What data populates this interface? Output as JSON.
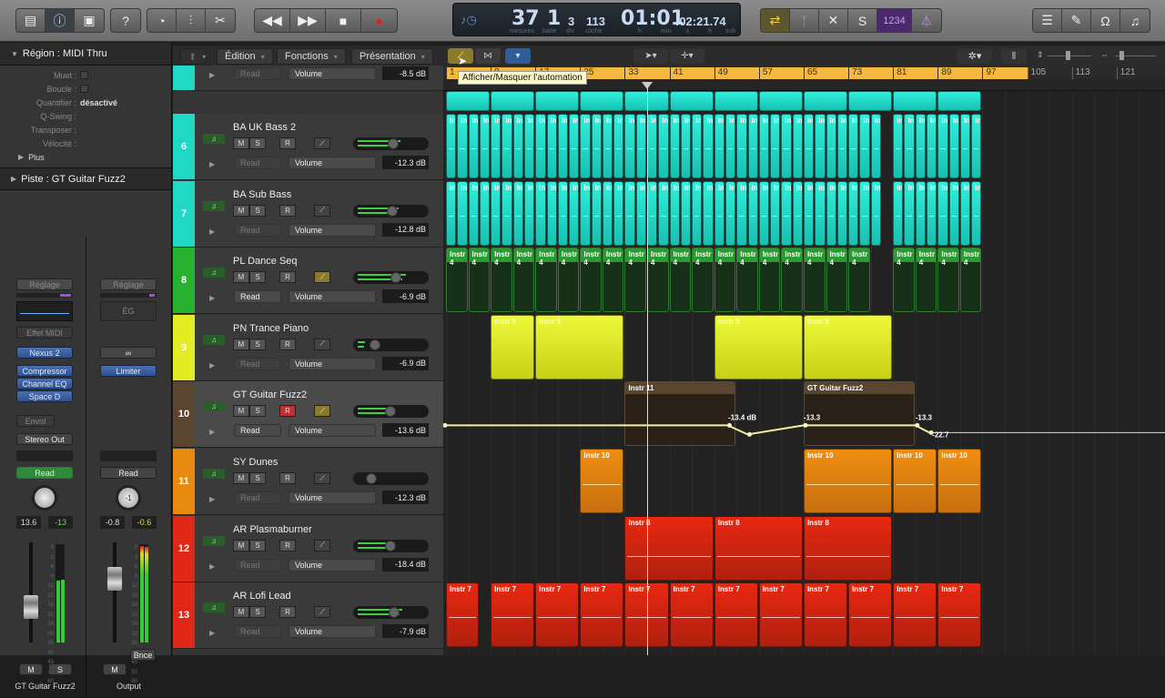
{
  "toolbar": {
    "left_buttons": [
      "library-icon",
      "inspector-icon",
      "toolbox-icon"
    ],
    "help": "?",
    "tools": [
      "tuner-icon",
      "mixer-icon",
      "scissors-icon"
    ],
    "transport": [
      "rewind-icon",
      "fast-forward-icon",
      "stop-icon",
      "play-icon",
      "record-icon"
    ],
    "lcd": {
      "bars": "37",
      "beat": "1",
      "div": "3",
      "tick": "113",
      "time_hm": "01:01",
      "time_rest": ":02:21.74",
      "labels": {
        "bars": "mesures",
        "beat": "batte",
        "div": "div",
        "tick": "coche",
        "h": "h",
        "min": "min.",
        "s": "s",
        "fr": "fr",
        "sub": "sub"
      }
    },
    "modes": {
      "cycle": "cycle-icon",
      "tuner": "tuning-fork-icon",
      "replace": "replace-icon",
      "solo": "S",
      "countin": "1234",
      "metronome": "metronome-icon"
    },
    "right": [
      "list-icon",
      "notepad-icon",
      "loops-icon",
      "browser-icon"
    ]
  },
  "inspector": {
    "region_title": "Région : MIDI Thru",
    "rows": [
      {
        "k": "Muet :",
        "type": "checkbox"
      },
      {
        "k": "Boucle :",
        "type": "checkbox"
      },
      {
        "k": "Quantifier :",
        "v": "désactivé"
      },
      {
        "k": "Q-Swing :",
        "v": ""
      },
      {
        "k": "Transposer :",
        "v": ""
      },
      {
        "k": "Vélocité :",
        "v": ""
      }
    ],
    "more": "Plus",
    "track_title": "Piste : GT Guitar Fuzz2",
    "strip1": {
      "setting": "Réglage",
      "midi_fx": "Effet MIDI",
      "instrument": "Nexus 2",
      "inserts": [
        "Compressor",
        "Channel EQ",
        "Space D"
      ],
      "sends": "Envol",
      "output": "Stereo Out",
      "automation": "Read",
      "pan_val": "13.6",
      "peak": "-13",
      "mute": "M",
      "solo": "S",
      "name": "GT Guitar Fuzz2"
    },
    "strip2": {
      "setting": "Réglage",
      "eq": "ÉG",
      "link": "∞",
      "inserts": [
        "Limiter"
      ],
      "automation": "Read",
      "pan_knob": "-1",
      "pan_val": "-0.8",
      "peak": "-0.6",
      "bounce": "Bnce",
      "mute": "M",
      "name": "Output"
    },
    "meter_scale": [
      "0",
      "3",
      "6",
      "9",
      "12",
      "15",
      "18",
      "21",
      "24",
      "30",
      "35",
      "40",
      "45",
      "50",
      "60"
    ]
  },
  "menubar": {
    "items": [
      "Édition",
      "Fonctions",
      "Présentation"
    ]
  },
  "tooltip": "Afficher/Masquer l'automation",
  "ruler": {
    "marks": [
      "1",
      "9",
      "17",
      "25",
      "33",
      "41",
      "49",
      "57",
      "65",
      "73",
      "81",
      "89",
      "97",
      "105",
      "113",
      "121"
    ]
  },
  "tracks": [
    {
      "num": "",
      "name": "",
      "mode": "Read",
      "param": "Volume",
      "db": "-8.5 dB",
      "color": "#20d8c4",
      "partial": true
    },
    {
      "num": "6",
      "name": "BA UK Bass 2",
      "mode": "Read",
      "param": "Volume",
      "db": "-12.3 dB",
      "color": "#20d8c4",
      "level": 0.62
    },
    {
      "num": "7",
      "name": "BA Sub Bass",
      "mode": "Read",
      "param": "Volume",
      "db": "-12.8 dB",
      "color": "#20d8c4",
      "level": 0.6
    },
    {
      "num": "8",
      "name": "PL Dance Seq",
      "mode": "Read",
      "param": "Volume",
      "db": "-6.9 dB",
      "color": "#28b030",
      "level": 0.7,
      "auto_on": true
    },
    {
      "num": "9",
      "name": "PN Trance Piano",
      "mode": "Read",
      "param": "Volume",
      "db": "-6.9 dB",
      "color": "#e4ec24",
      "level": 0.1
    },
    {
      "num": "10",
      "name": "GT Guitar Fuzz2",
      "mode": "Read",
      "param": "Volume",
      "db": "-13.6 dB",
      "color": "#5a4530",
      "level": 0.55,
      "auto_on": true,
      "rec": true,
      "selected": true
    },
    {
      "num": "11",
      "name": "SY Dunes",
      "mode": "Read",
      "param": "Volume",
      "db": "-12.3 dB",
      "color": "#e88a10",
      "level": 0
    },
    {
      "num": "12",
      "name": "AR Plasmaburner",
      "mode": "Read",
      "param": "Volume",
      "db": "-18.4 dB",
      "color": "#e02818",
      "level": 0.55
    },
    {
      "num": "13",
      "name": "AR Lofi Lead",
      "mode": "Read",
      "param": "Volume",
      "db": "-7.9 dB",
      "color": "#e02818",
      "level": 0.65
    }
  ],
  "track_buttons": {
    "mute": "M",
    "solo": "S",
    "rec": "R"
  },
  "regions": {
    "bass_label": "Inst",
    "seq_label": "Instr 4",
    "piano": [
      {
        "label": "Instr 5",
        "start": 9,
        "end": 17
      },
      {
        "label": "Instr 5",
        "start": 17,
        "end": 33
      },
      {
        "label": "Instr 5",
        "start": 49,
        "end": 65
      },
      {
        "label": "Instr 5",
        "start": 65,
        "end": 81
      }
    ],
    "guitar": [
      {
        "label": "Instr 11",
        "start": 33,
        "end": 53
      },
      {
        "label": "GT Guitar Fuzz2",
        "start": 65,
        "end": 85
      }
    ],
    "dunes": [
      {
        "label": "Instr 10",
        "start": 25,
        "end": 33
      },
      {
        "label": "Instr 10",
        "start": 65,
        "end": 81
      },
      {
        "label": "Instr 10",
        "start": 81,
        "end": 89
      },
      {
        "label": "Instr 10",
        "start": 89,
        "end": 97
      }
    ],
    "plasma": [
      {
        "label": "Instr 8",
        "start": 33,
        "end": 49
      },
      {
        "label": "Instr 8",
        "start": 49,
        "end": 65
      },
      {
        "label": "Instr 8",
        "start": 65,
        "end": 81
      }
    ],
    "lofi": [
      {
        "label": "Instr 7",
        "start": 1,
        "end": 7
      },
      {
        "label": "Instr 7",
        "start": 9,
        "end": 17
      },
      {
        "label": "Instr 7",
        "start": 17,
        "end": 25
      },
      {
        "label": "Instr 7",
        "start": 25,
        "end": 33
      },
      {
        "label": "Instr 7",
        "start": 33,
        "end": 41
      },
      {
        "label": "Instr 7",
        "start": 41,
        "end": 49
      },
      {
        "label": "Instr 7",
        "start": 49,
        "end": 57
      },
      {
        "label": "Instr 7",
        "start": 57,
        "end": 65
      },
      {
        "label": "Instr 7",
        "start": 65,
        "end": 73
      },
      {
        "label": "Instr 7",
        "start": 73,
        "end": 81
      },
      {
        "label": "Instr 7",
        "start": 81,
        "end": 89
      },
      {
        "label": "Instr 7",
        "start": 89,
        "end": 97
      }
    ]
  },
  "automation": {
    "labels": [
      "-13.4 dB",
      "-13.3",
      "-13.3",
      "-22.7"
    ]
  },
  "playhead_bar": 37
}
